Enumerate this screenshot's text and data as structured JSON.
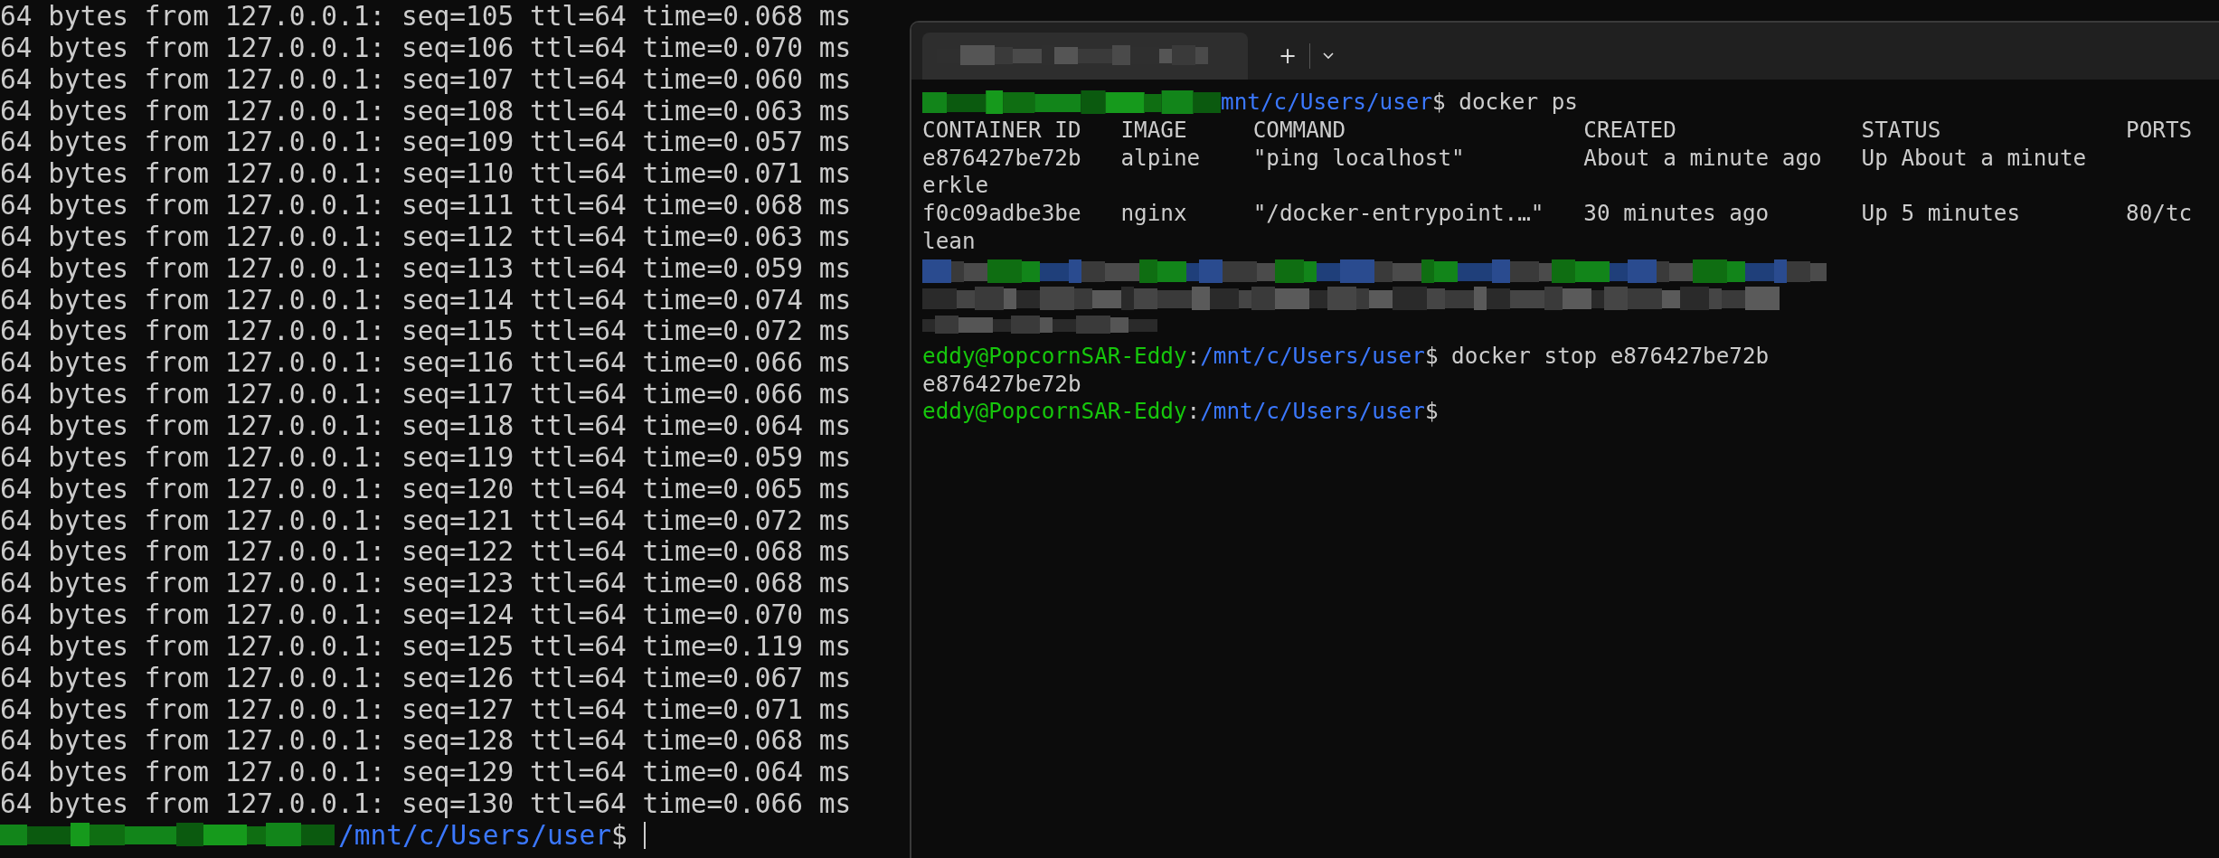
{
  "left_terminal": {
    "lines": [
      "64 bytes from 127.0.0.1: seq=105 ttl=64 time=0.068 ms",
      "64 bytes from 127.0.0.1: seq=106 ttl=64 time=0.070 ms",
      "64 bytes from 127.0.0.1: seq=107 ttl=64 time=0.060 ms",
      "64 bytes from 127.0.0.1: seq=108 ttl=64 time=0.063 ms",
      "64 bytes from 127.0.0.1: seq=109 ttl=64 time=0.057 ms",
      "64 bytes from 127.0.0.1: seq=110 ttl=64 time=0.071 ms",
      "64 bytes from 127.0.0.1: seq=111 ttl=64 time=0.068 ms",
      "64 bytes from 127.0.0.1: seq=112 ttl=64 time=0.063 ms",
      "64 bytes from 127.0.0.1: seq=113 ttl=64 time=0.059 ms",
      "64 bytes from 127.0.0.1: seq=114 ttl=64 time=0.074 ms",
      "64 bytes from 127.0.0.1: seq=115 ttl=64 time=0.072 ms",
      "64 bytes from 127.0.0.1: seq=116 ttl=64 time=0.066 ms",
      "64 bytes from 127.0.0.1: seq=117 ttl=64 time=0.066 ms",
      "64 bytes from 127.0.0.1: seq=118 ttl=64 time=0.064 ms",
      "64 bytes from 127.0.0.1: seq=119 ttl=64 time=0.059 ms",
      "64 bytes from 127.0.0.1: seq=120 ttl=64 time=0.065 ms",
      "64 bytes from 127.0.0.1: seq=121 ttl=64 time=0.072 ms",
      "64 bytes from 127.0.0.1: seq=122 ttl=64 time=0.068 ms",
      "64 bytes from 127.0.0.1: seq=123 ttl=64 time=0.068 ms",
      "64 bytes from 127.0.0.1: seq=124 ttl=64 time=0.070 ms",
      "64 bytes from 127.0.0.1: seq=125 ttl=64 time=0.119 ms",
      "64 bytes from 127.0.0.1: seq=126 ttl=64 time=0.067 ms",
      "64 bytes from 127.0.0.1: seq=127 ttl=64 time=0.071 ms",
      "64 bytes from 127.0.0.1: seq=128 ttl=64 time=0.068 ms",
      "64 bytes from 127.0.0.1: seq=129 ttl=64 time=0.064 ms",
      "64 bytes from 127.0.0.1: seq=130 ttl=64 time=0.066 ms"
    ],
    "prompt": {
      "path": "/mnt/c/Users/user",
      "symbol": "$"
    }
  },
  "right_terminal": {
    "new_tab": "+",
    "entries": [
      {
        "kind": "prompt",
        "path": "mnt/c/Users/user",
        "symbol": "$",
        "command": "docker ps"
      },
      {
        "kind": "table",
        "columns": [
          "CONTAINER ID",
          "IMAGE",
          "COMMAND",
          "CREATED",
          "STATUS",
          "PORTS"
        ],
        "rows": [
          [
            "e876427be72b",
            "alpine",
            "\"ping localhost\"",
            "About a minute ago",
            "Up About a minute"
          ],
          [
            "erkle"
          ],
          [
            "f0c09adbe3be",
            "nginx",
            "\"/docker-entrypoint.…\"",
            "30 minutes ago",
            "Up 5 minutes",
            "80/tc"
          ],
          [
            "lean"
          ]
        ]
      },
      {
        "kind": "redacted"
      },
      {
        "kind": "prompt",
        "user": "eddy@PopcornSAR-Eddy",
        "separator": ":",
        "path": "/mnt/c/Users/user",
        "symbol": "$",
        "command": "docker stop e876427be72b"
      },
      {
        "kind": "output",
        "text": "e876427be72b"
      },
      {
        "kind": "prompt",
        "user": "eddy@PopcornSAR-Eddy",
        "separator": ":",
        "path": "/mnt/c/Users/user",
        "symbol": "$"
      }
    ]
  }
}
